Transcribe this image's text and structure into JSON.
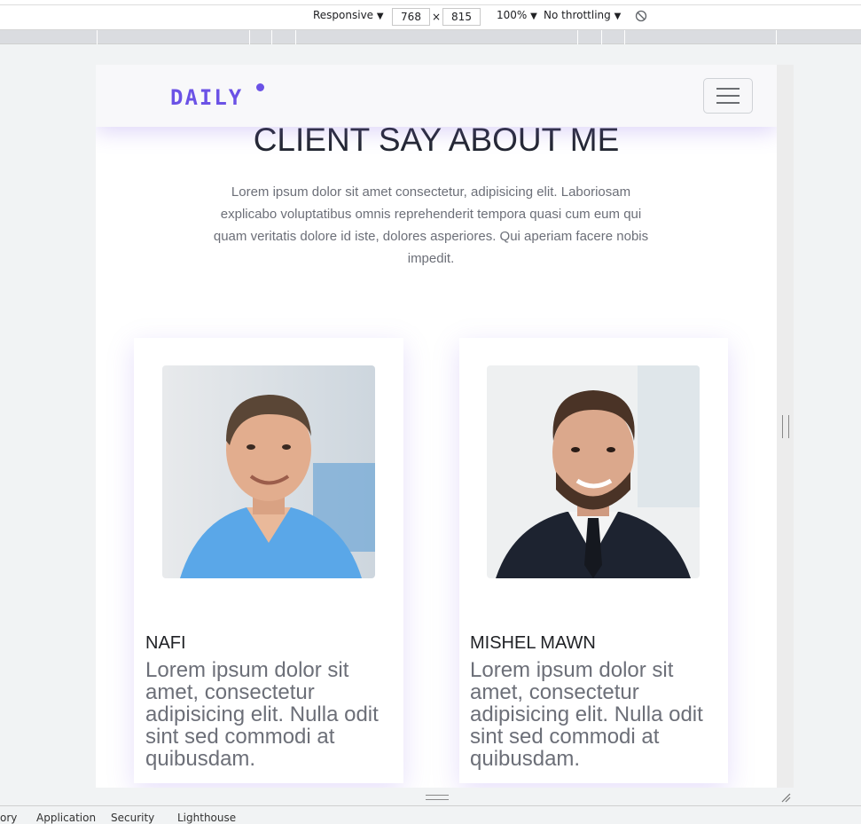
{
  "devtools": {
    "device_label": "Responsive",
    "width_value": "768",
    "times_symbol": "×",
    "height_value": "815",
    "zoom_label": "100%",
    "throttle_label": "No throttling",
    "dropdown_arrow": "▼",
    "rotate_icon": "rotate-icon",
    "tabs": [
      "ory",
      "Application",
      "Security",
      "Lighthouse"
    ]
  },
  "site": {
    "logo": "DAILY",
    "menu_icon": "hamburger-icon",
    "section_title": "CLIENT SAY ABOUT ME",
    "section_description": "Lorem ipsum dolor sit amet consectetur, adipisicing elit. Laboriosam explicabo voluptatibus omnis reprehenderit tempora quasi cum eum qui quam veritatis dolore id iste, dolores asperiores. Qui aperiam facere nobis impedit.",
    "testimonials": [
      {
        "name": "NAFI",
        "text": "Lorem ipsum dolor sit amet, consectetur adipisicing elit. Nulla odit sint sed commodi at quibusdam."
      },
      {
        "name": "MISHEL MAWN",
        "text": "Lorem ipsum dolor sit amet, consectetur adipisicing elit. Nulla odit sint sed commodi at quibusdam."
      }
    ]
  },
  "colors": {
    "brand": "#6b52e6",
    "title": "#222630",
    "body_text": "#6c6f78"
  }
}
